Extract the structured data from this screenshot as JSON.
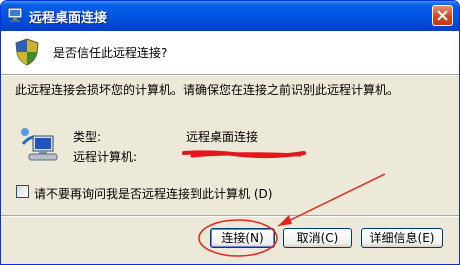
{
  "window": {
    "title": "远程桌面连接",
    "icon": "remote-desktop-icon"
  },
  "header": {
    "question": "是否信任此远程连接?",
    "icon": "shield-icon"
  },
  "body": {
    "warning": "此远程连接会损坏您的计算机。请确保您在连接之前识别此远程计算机。",
    "type_label": "类型:",
    "type_value": "远程桌面连接",
    "computer_label": "远程计算机:",
    "computer_value_redacted": true
  },
  "checkbox": {
    "label": "请不要再询问我是否远程连接到此计算机 (D)",
    "checked": false
  },
  "buttons": {
    "connect": "连接(N)",
    "cancel": "取消(C)",
    "details": "详细信息(E)"
  },
  "annotation": {
    "color": "#e8231b"
  },
  "colors": {
    "titlebar": "#0055e5",
    "dialog_bg": "#ece9d8",
    "close_button": "#d1401c"
  }
}
